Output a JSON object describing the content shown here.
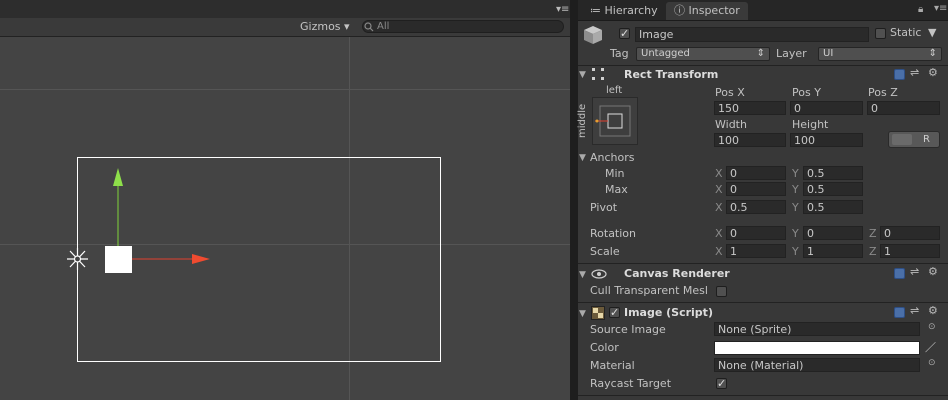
{
  "scene": {
    "gizmos_label": "Gizmos",
    "search_placeholder": "All"
  },
  "tabs": [
    {
      "label": "Hierarchy",
      "icon": "list-icon"
    },
    {
      "label": "Inspector",
      "icon": "info-icon"
    }
  ],
  "object": {
    "enabled": true,
    "name": "Image",
    "static_label": "Static",
    "tag_label": "Tag",
    "tag_value": "Untagged",
    "layer_label": "Layer",
    "layer_value": "UI"
  },
  "rect_transform": {
    "title": "Rect Transform",
    "anchor_horizontal": "left",
    "anchor_vertical": "middle",
    "col1": "Pos X",
    "col2": "Pos Y",
    "col3": "Pos Z",
    "pos_x": "150",
    "pos_y": "0",
    "pos_z": "0",
    "width_label": "Width",
    "height_label": "Height",
    "width": "100",
    "height": "100",
    "r_button": "R",
    "anchors_label": "Anchors",
    "min_label": "Min",
    "max_label": "Max",
    "min_x": "0",
    "min_y": "0.5",
    "max_x": "0",
    "max_y": "0.5",
    "pivot_label": "Pivot",
    "pivot_x": "0.5",
    "pivot_y": "0.5",
    "rotation_label": "Rotation",
    "rot_x": "0",
    "rot_y": "0",
    "rot_z": "0",
    "scale_label": "Scale",
    "scale_x": "1",
    "scale_y": "1",
    "scale_z": "1",
    "x": "X",
    "y": "Y",
    "z": "Z"
  },
  "canvas_renderer": {
    "title": "Canvas Renderer",
    "cull_label": "Cull Transparent Mesl"
  },
  "image_script": {
    "title": "Image (Script)",
    "source_label": "Source Image",
    "source_value": "None (Sprite)",
    "color_label": "Color",
    "color_value": "#ffffff",
    "material_label": "Material",
    "material_value": "None (Material)",
    "raycast_label": "Raycast Target",
    "raycast_checked": true
  }
}
